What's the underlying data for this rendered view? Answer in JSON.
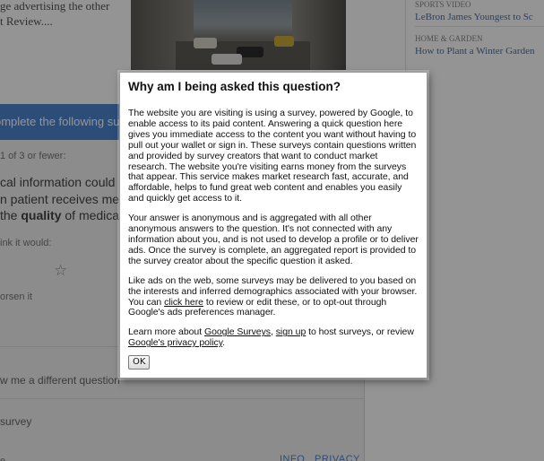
{
  "article": {
    "line1": "ge advertising the other",
    "line2": "t Review...."
  },
  "right_column": {
    "cat1": "SPORTS VIDEO",
    "link1": "LeBron James Youngest to Sc",
    "cat2": "HOME & GARDEN",
    "link2": "How to Plant a Winter Garden"
  },
  "survey": {
    "header": "omplete the following su",
    "step": "1 of 3 or fewer:",
    "question_line1": "cal information could",
    "question_line2": "n patient receives med",
    "question_line3_pre": "the ",
    "question_line3_bold": "quality",
    "question_line3_post": " of medical",
    "scale_label": "ink it would:",
    "worsen_label": "orsen it",
    "different_question": "w me a different question",
    "survey_link": "survey",
    "footer_info": "INFO",
    "footer_privacy": "PRIVACY",
    "footer_left": "e"
  },
  "dialog": {
    "title": "Why am I being asked this question?",
    "p1": "The website you are visiting is using a survey, powered by Google, to enable access to its paid content. Answering a quick question here gives you immediate access to the content you want without having to pull out your wallet or sign in. These surveys contain questions written and provided by survey creators that want to conduct market research. The website you're visiting earns money from the surveys that appear. This service makes market research fast, accurate, and affordable, helps to fund great web content and enables you easily and quickly get access to it.",
    "p2": "Your answer is anonymous and is aggregated with all other anonymous answers to the question. It's not connected with any information about you, and is not used to develop a profile or to deliver ads. Once the survey is complete, an aggregated report is provided to the survey creator about the specific question it asked.",
    "p3_a": "Like ads on the web, some surveys may be delivered to you based on the interests and inferred demographics associated with your browser. You can ",
    "p3_link": "click here",
    "p3_b": " to review or edit these, or to opt-out through Google's ads preferences manager.",
    "p4_a": "Learn more about ",
    "p4_link1": "Google Surveys",
    "p4_b": ", ",
    "p4_link2": "sign up",
    "p4_c": " to host surveys, or review ",
    "p4_link3": "Google's privacy policy",
    "p4_d": ".",
    "ok_label": "OK"
  },
  "colors": {
    "survey_header": "#4f86d0",
    "overlay": "rgba(0,0,0,0.42)",
    "link_blue": "#4a6fa5"
  }
}
